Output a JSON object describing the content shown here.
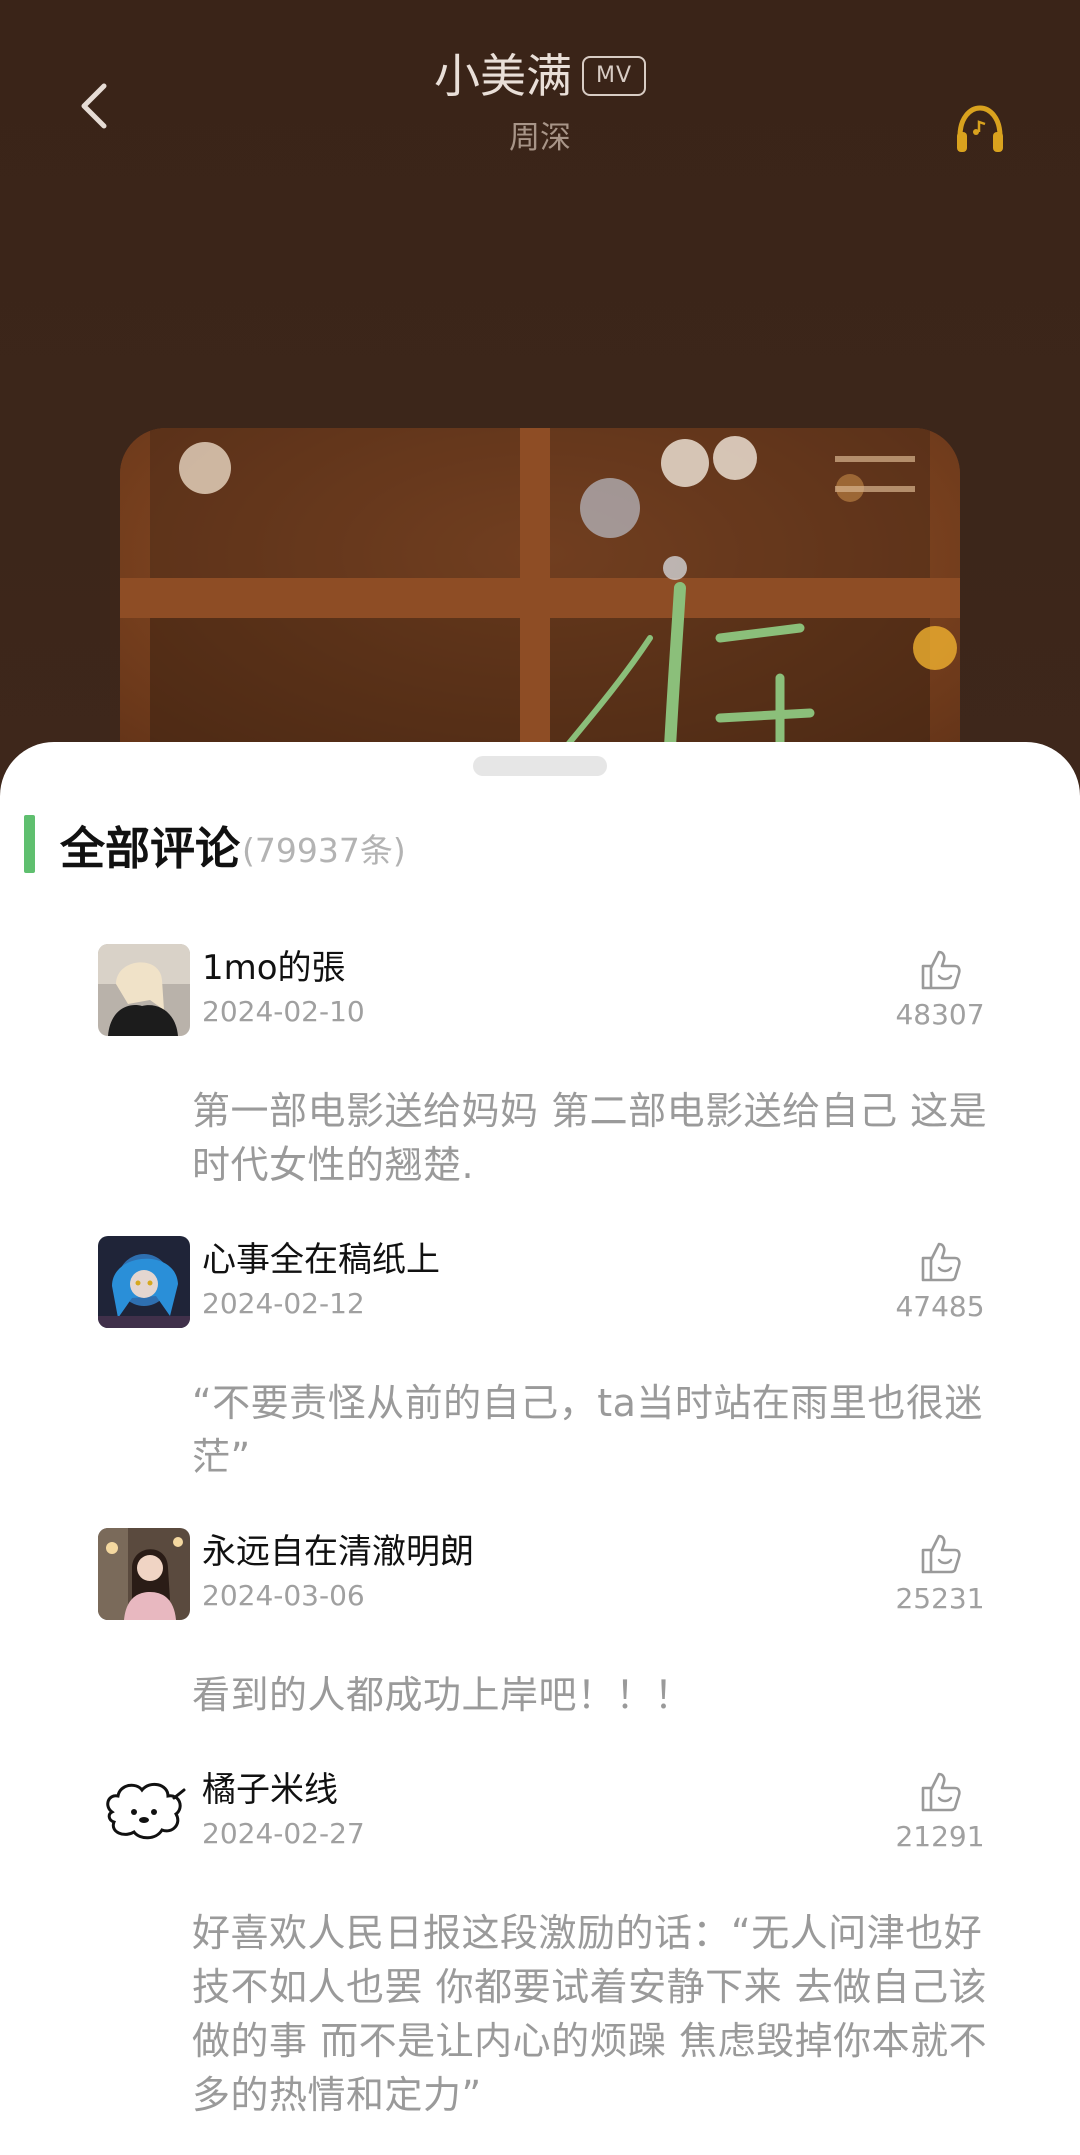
{
  "header": {
    "song_title": "小美满",
    "mv_badge": "MV",
    "artist": "周深"
  },
  "icons": {
    "back": "chevron-left-icon",
    "headphone": "headphone-icon",
    "like": "thumbs-up-icon"
  },
  "colors": {
    "accent": "#5fbf6f",
    "headphone": "#d9a21e",
    "sheet_bg": "#ffffff",
    "player_bg": "#3b2519"
  },
  "comments_section": {
    "title": "全部评论",
    "count": "(79937条)"
  },
  "comments": [
    {
      "user": "1mo的張",
      "date": "2024-02-10",
      "likes": "48307",
      "text": "第一部电影送给妈妈 第二部电影送给自己 这是时代女性的翘楚."
    },
    {
      "user": "心事全在稿纸上",
      "date": "2024-02-12",
      "likes": "47485",
      "text": "“不要责怪从前的自己，ta当时站在雨里也很迷茫”"
    },
    {
      "user": "永远自在清澈明朗",
      "date": "2024-03-06",
      "likes": "25231",
      "text": "看到的人都成功上岸吧！！！"
    },
    {
      "user": "橘子米线",
      "date": "2024-02-27",
      "likes": "21291",
      "text": "好喜欢人民日报这段激励的话：“无人问津也好 技不如人也罢 你都要试着安静下来 去做自己该做的事 而不是让内心的烦躁 焦虑毁掉你本就不多的热情和定力”"
    }
  ]
}
